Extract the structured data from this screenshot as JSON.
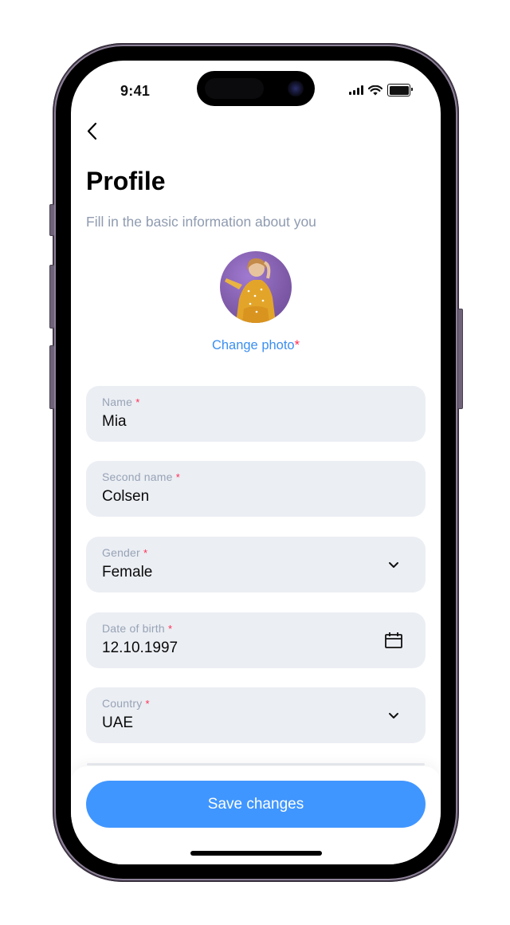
{
  "status_bar": {
    "time": "9:41",
    "signal_icon": "cellular-signal-icon",
    "wifi_icon": "wifi-icon",
    "battery_icon": "battery-icon"
  },
  "header": {
    "back_icon": "chevron-left-icon",
    "title": "Profile",
    "subtitle": "Fill in the basic information about you"
  },
  "photo": {
    "change_label": "Change photo",
    "required_mark": "*"
  },
  "fields": [
    {
      "label": "Name",
      "required": "*",
      "value": "Mia",
      "icon": null
    },
    {
      "label": "Second name",
      "required": "*",
      "value": "Colsen",
      "icon": null
    },
    {
      "label": "Gender",
      "required": "*",
      "value": "Female",
      "icon": "chevron-down-icon"
    },
    {
      "label": "Date of birth",
      "required": "*",
      "value": "12.10.1997",
      "icon": "calendar-icon"
    },
    {
      "label": "Country",
      "required": "*",
      "value": "UAE",
      "icon": "chevron-down-icon"
    }
  ],
  "footer": {
    "save_label": "Save changes"
  },
  "colors": {
    "accent": "#4096ff",
    "link": "#3b8ff0",
    "required": "#ff2d55",
    "field_bg": "#ebeef3",
    "label": "#97a3b6",
    "subtitle": "#8f9bb0"
  }
}
